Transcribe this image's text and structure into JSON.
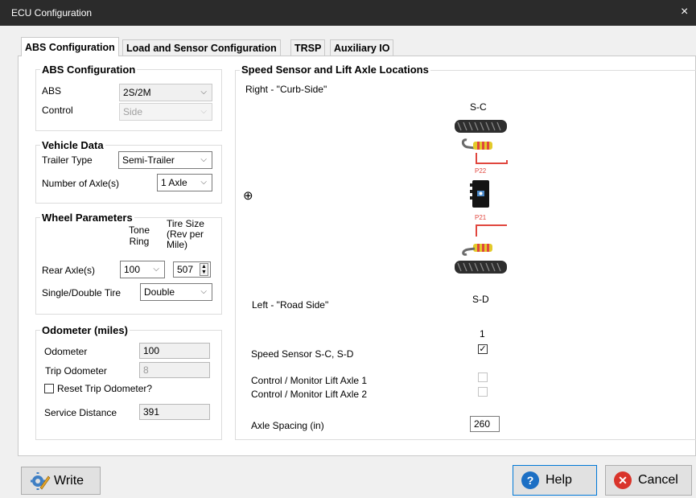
{
  "window": {
    "title": "ECU Configuration",
    "close": "×"
  },
  "tabs": [
    "ABS Configuration",
    "Load and Sensor Configuration",
    "TRSP",
    "Auxiliary IO"
  ],
  "abs": {
    "title": "ABS Configuration",
    "abs_label": "ABS",
    "abs_value": "2S/2M",
    "control_label": "Control",
    "control_value": "Side"
  },
  "vehicle": {
    "title": "Vehicle Data",
    "trailer_label": "Trailer Type",
    "trailer_value": "Semi-Trailer",
    "axles_label": "Number of Axle(s)",
    "axles_value": "1 Axle"
  },
  "wheel": {
    "title": "Wheel Parameters",
    "tone_header": "Tone\nRing",
    "tire_header": "Tire Size\n(Rev per\nMile)",
    "rear_label": "Rear Axle(s)",
    "tone_value": "100",
    "tire_value": "507",
    "single_label": "Single/Double Tire",
    "single_value": "Double"
  },
  "odometer": {
    "title": "Odometer (miles)",
    "odo_label": "Odometer",
    "odo_value": "100",
    "trip_label": "Trip Odometer",
    "trip_value": "8",
    "reset_label": "Reset Trip Odometer?",
    "service_label": "Service Distance",
    "service_value": "391"
  },
  "sensor": {
    "title": "Speed Sensor and Lift Axle Locations",
    "right_label": "Right - \"Curb-Side\"",
    "left_label": "Left - \"Road Side\"",
    "top_wheel": "S-C",
    "bottom_wheel": "S-D",
    "port_top": "P22",
    "port_bottom": "P21",
    "crosshair": "⊕",
    "axle_col": "1",
    "speed_label": "Speed Sensor S-C, S-D",
    "speed_checked": true,
    "lift1_label": "Control / Monitor Lift Axle 1",
    "lift2_label": "Control / Monitor Lift Axle 2",
    "spacing_label": "Axle Spacing (in)",
    "spacing_value": "260"
  },
  "buttons": {
    "write": "Write",
    "help": "Help",
    "cancel": "Cancel"
  },
  "colors": {
    "help_blue": "#1c6fc4",
    "cancel_red": "#d9342b",
    "wire_red": "#e0463e",
    "focus": "#0078d7"
  }
}
